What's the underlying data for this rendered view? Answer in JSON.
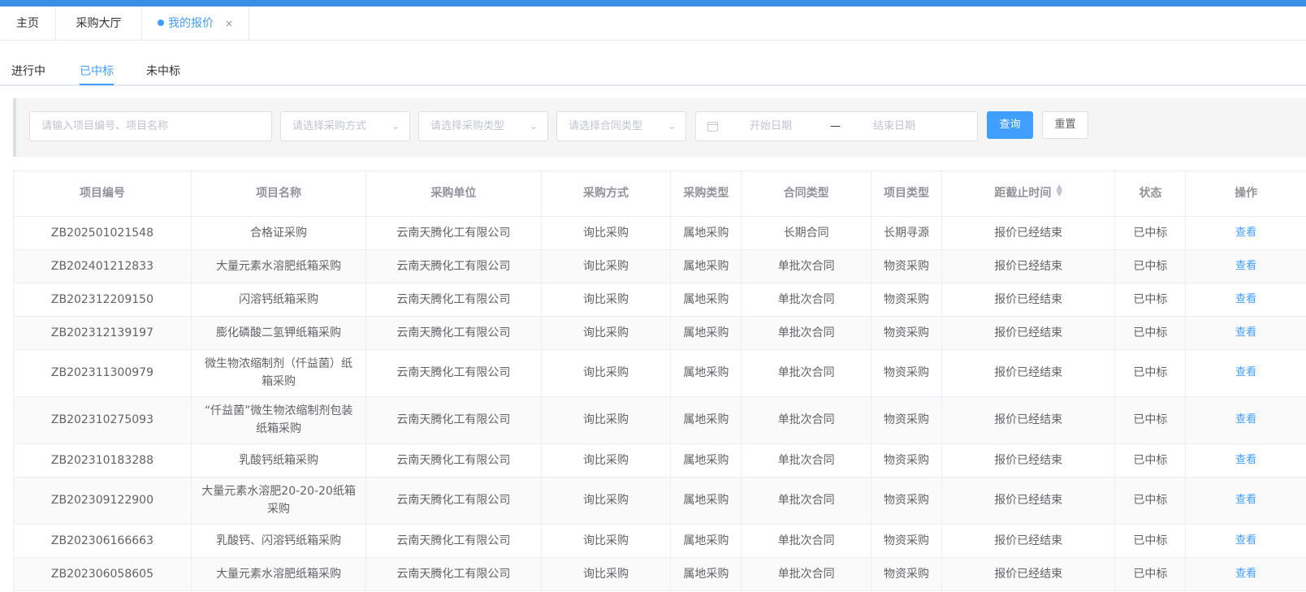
{
  "tabs": [
    {
      "label": "主页"
    },
    {
      "label": "采购大厅"
    },
    {
      "label": "我的报价",
      "close": "×"
    }
  ],
  "sub_tabs": [
    {
      "label": "进行中"
    },
    {
      "label": "已中标",
      "active": true
    },
    {
      "label": "未中标"
    }
  ],
  "filter": {
    "keyword_placeholder": "请输入项目编号、项目名称",
    "method_placeholder": "请选择采购方式",
    "ptype_placeholder": "请选择采购类型",
    "ctype_placeholder": "请选择合同类型",
    "date_start_placeholder": "开始日期",
    "date_separator": "—",
    "date_end_placeholder": "结束日期",
    "query_label": "查询",
    "reset_label": "重置"
  },
  "table": {
    "headers": [
      "项目编号",
      "项目名称",
      "采购单位",
      "采购方式",
      "采购类型",
      "合同类型",
      "项目类型",
      "距截止时间",
      "状态",
      "操作"
    ],
    "rows": [
      {
        "code": "ZB202501021548",
        "name": "合格证采购",
        "unit": "云南天腾化工有限公司",
        "method": "询比采购",
        "ptype": "属地采购",
        "ctype": "长期合同",
        "itype": "长期寻源",
        "deadline": "报价已经结束",
        "status": "已中标",
        "op": "查看"
      },
      {
        "code": "ZB202401212833",
        "name": "大量元素水溶肥纸箱采购",
        "unit": "云南天腾化工有限公司",
        "method": "询比采购",
        "ptype": "属地采购",
        "ctype": "单批次合同",
        "itype": "物资采购",
        "deadline": "报价已经结束",
        "status": "已中标",
        "op": "查看"
      },
      {
        "code": "ZB202312209150",
        "name": "闪溶钙纸箱采购",
        "unit": "云南天腾化工有限公司",
        "method": "询比采购",
        "ptype": "属地采购",
        "ctype": "单批次合同",
        "itype": "物资采购",
        "deadline": "报价已经结束",
        "status": "已中标",
        "op": "查看"
      },
      {
        "code": "ZB202312139197",
        "name": "膨化磷酸二氢钾纸箱采购",
        "unit": "云南天腾化工有限公司",
        "method": "询比采购",
        "ptype": "属地采购",
        "ctype": "单批次合同",
        "itype": "物资采购",
        "deadline": "报价已经结束",
        "status": "已中标",
        "op": "查看"
      },
      {
        "code": "ZB202311300979",
        "name": "微生物浓缩制剂（仟益菌）纸箱采购",
        "unit": "云南天腾化工有限公司",
        "method": "询比采购",
        "ptype": "属地采购",
        "ctype": "单批次合同",
        "itype": "物资采购",
        "deadline": "报价已经结束",
        "status": "已中标",
        "op": "查看"
      },
      {
        "code": "ZB202310275093",
        "name": "“仟益菌”微生物浓缩制剂包装纸箱采购",
        "unit": "云南天腾化工有限公司",
        "method": "询比采购",
        "ptype": "属地采购",
        "ctype": "单批次合同",
        "itype": "物资采购",
        "deadline": "报价已经结束",
        "status": "已中标",
        "op": "查看"
      },
      {
        "code": "ZB202310183288",
        "name": "乳酸钙纸箱采购",
        "unit": "云南天腾化工有限公司",
        "method": "询比采购",
        "ptype": "属地采购",
        "ctype": "单批次合同",
        "itype": "物资采购",
        "deadline": "报价已经结束",
        "status": "已中标",
        "op": "查看"
      },
      {
        "code": "ZB202309122900",
        "name": "大量元素水溶肥20-20-20纸箱采购",
        "unit": "云南天腾化工有限公司",
        "method": "询比采购",
        "ptype": "属地采购",
        "ctype": "单批次合同",
        "itype": "物资采购",
        "deadline": "报价已经结束",
        "status": "已中标",
        "op": "查看"
      },
      {
        "code": "ZB202306166663",
        "name": "乳酸钙、闪溶钙纸箱采购",
        "unit": "云南天腾化工有限公司",
        "method": "询比采购",
        "ptype": "属地采购",
        "ctype": "单批次合同",
        "itype": "物资采购",
        "deadline": "报价已经结束",
        "status": "已中标",
        "op": "查看"
      },
      {
        "code": "ZB202306058605",
        "name": "大量元素水溶肥纸箱采购",
        "unit": "云南天腾化工有限公司",
        "method": "询比采购",
        "ptype": "属地采购",
        "ctype": "单批次合同",
        "itype": "物资采购",
        "deadline": "报价已经结束",
        "status": "已中标",
        "op": "查看"
      }
    ]
  },
  "colors": {
    "accent": "#409eff",
    "top_bar": "#3a8ee6"
  }
}
